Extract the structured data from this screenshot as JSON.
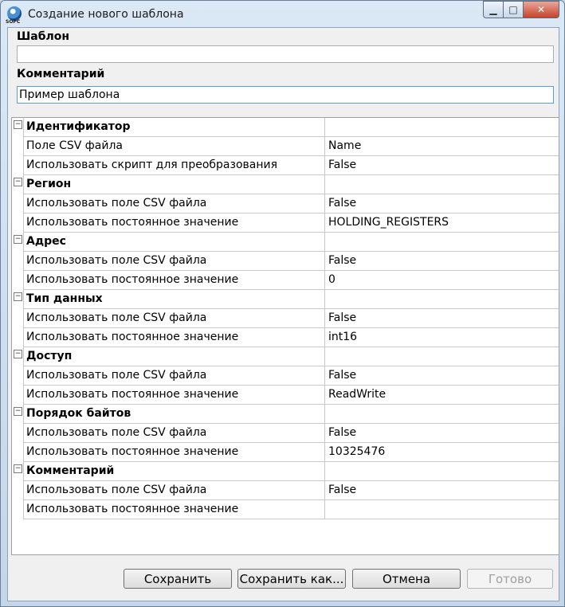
{
  "window": {
    "title": "Создание нового шаблона",
    "icon_label": "SOPC",
    "caption_min": "▁",
    "caption_max": "□",
    "caption_close": "✕"
  },
  "form": {
    "template_label": "Шаблон",
    "template_value": "",
    "comment_label": "Комментарий",
    "comment_value": "Пример шаблона"
  },
  "grid": {
    "rows": [
      {
        "type": "category",
        "name": "Идентификатор",
        "value": ""
      },
      {
        "type": "prop",
        "name": "Поле CSV файла",
        "value": "Name"
      },
      {
        "type": "prop",
        "name": "Использовать скрипт для преобразования",
        "value": "False"
      },
      {
        "type": "category",
        "name": "Регион",
        "value": ""
      },
      {
        "type": "prop",
        "name": "Использовать поле CSV файла",
        "value": "False"
      },
      {
        "type": "prop",
        "name": "Использовать постоянное значение",
        "value": "HOLDING_REGISTERS"
      },
      {
        "type": "category",
        "name": "Адрес",
        "value": ""
      },
      {
        "type": "prop",
        "name": "Использовать поле CSV файла",
        "value": "False"
      },
      {
        "type": "prop",
        "name": "Использовать постоянное значение",
        "value": "0"
      },
      {
        "type": "category",
        "name": "Тип данных",
        "value": ""
      },
      {
        "type": "prop",
        "name": "Использовать поле CSV файла",
        "value": "False"
      },
      {
        "type": "prop",
        "name": "Использовать постоянное значение",
        "value": "int16"
      },
      {
        "type": "category",
        "name": "Доступ",
        "value": ""
      },
      {
        "type": "prop",
        "name": "Использовать поле CSV файла",
        "value": "False"
      },
      {
        "type": "prop",
        "name": "Использовать постоянное значение",
        "value": "ReadWrite"
      },
      {
        "type": "category",
        "name": "Порядок байтов",
        "value": ""
      },
      {
        "type": "prop",
        "name": "Использовать поле CSV файла",
        "value": "False"
      },
      {
        "type": "prop",
        "name": "Использовать постоянное значение",
        "value": "10325476"
      },
      {
        "type": "category",
        "name": "Комментарий",
        "value": ""
      },
      {
        "type": "prop",
        "name": "Использовать поле CSV файла",
        "value": "False"
      },
      {
        "type": "prop",
        "name": "Использовать постоянное значение",
        "value": ""
      }
    ],
    "expander_glyph": "−"
  },
  "buttons": {
    "save": "Сохранить",
    "save_as": "Сохранить как...",
    "cancel": "Отмена",
    "done": "Готово"
  }
}
